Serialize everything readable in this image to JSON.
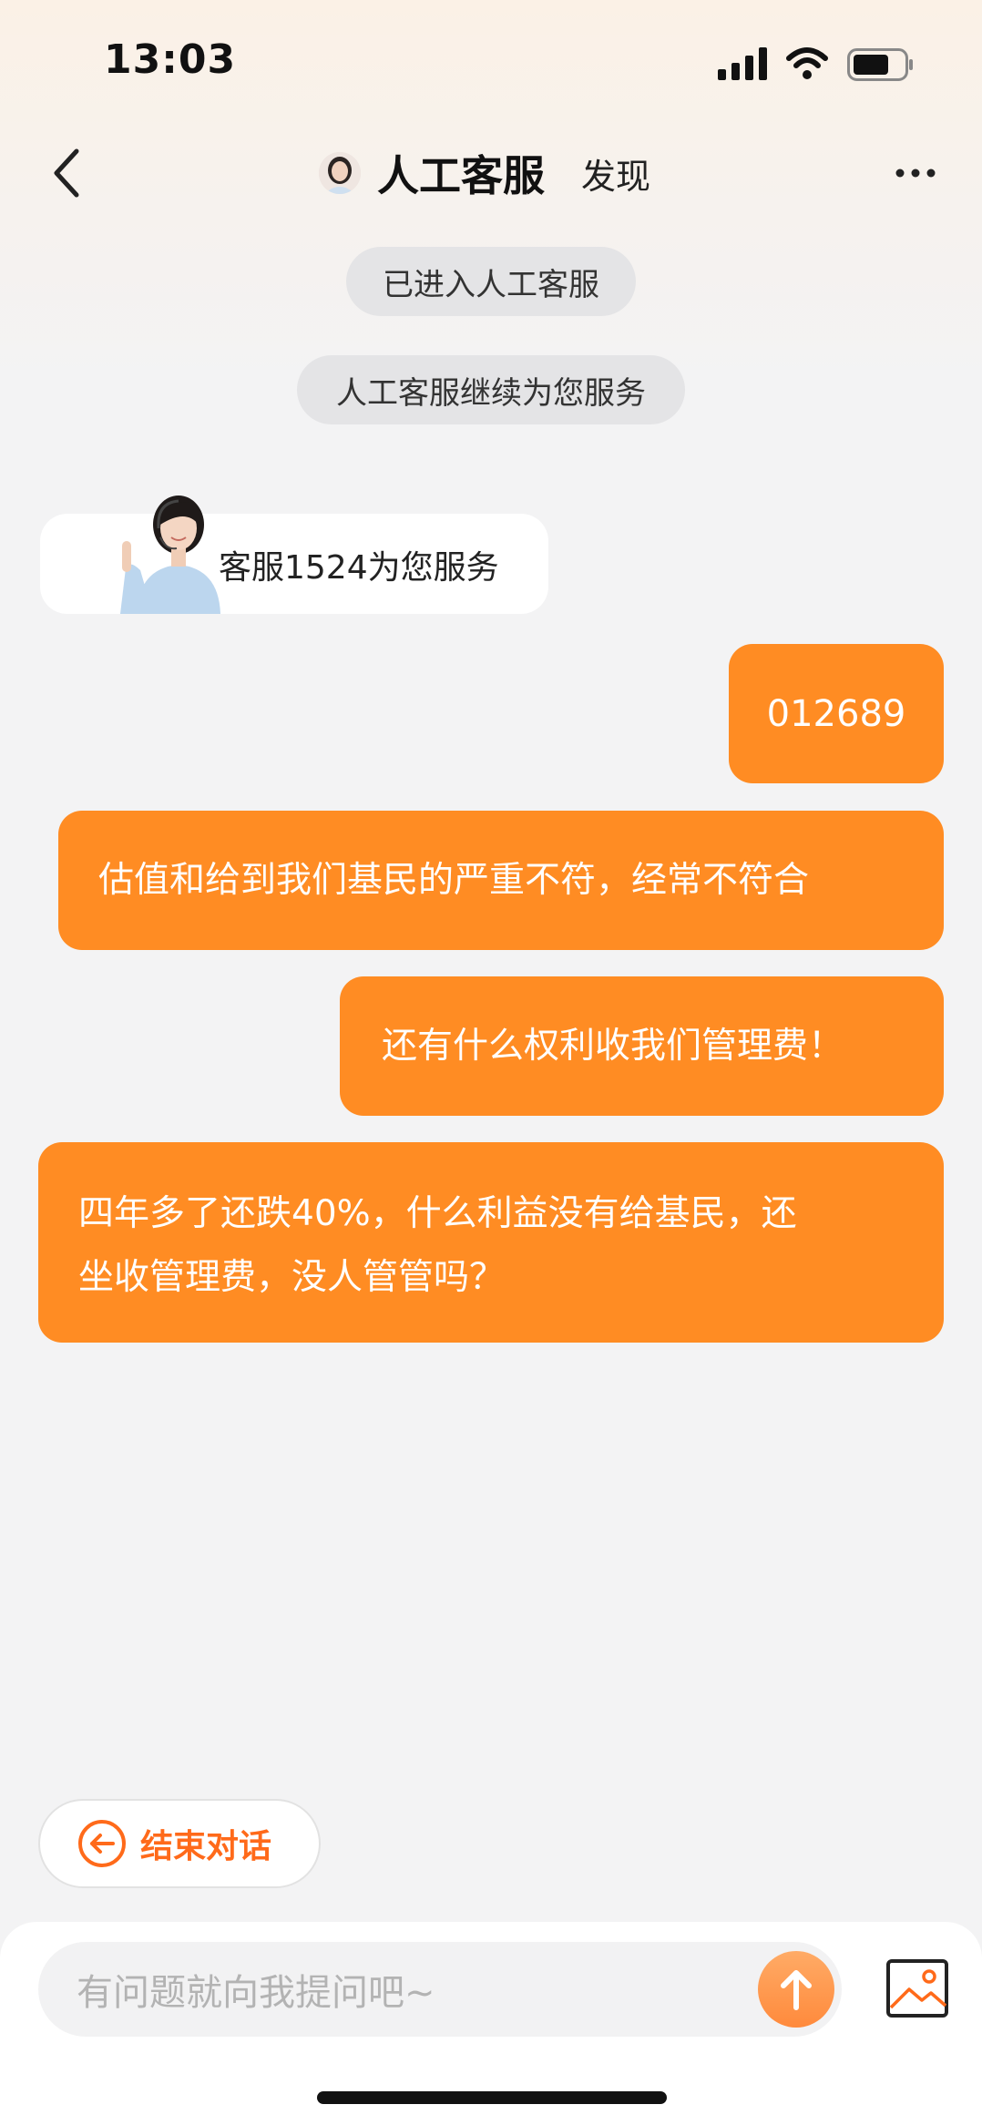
{
  "status_bar": {
    "time": "13:03"
  },
  "nav": {
    "title": "人工客服",
    "discover": "发现"
  },
  "system_messages": [
    "已进入人工客服",
    "人工客服继续为您服务"
  ],
  "agent_card": {
    "text": "客服1524为您服务"
  },
  "messages": [
    {
      "side": "right",
      "text": "012689"
    },
    {
      "side": "right",
      "text": "估值和给到我们基民的严重不符，经常不符合"
    },
    {
      "side": "right",
      "text": "还有什么权利收我们管理费！"
    },
    {
      "side": "right",
      "lines": [
        "四年多了还跌40%，什么利益没有给基民，还",
        "坐收管理费，没人管管吗？"
      ]
    }
  ],
  "end_chat": {
    "label": "结束对话"
  },
  "input": {
    "placeholder": "有问题就向我提问吧~"
  },
  "colors": {
    "accent": "#ff8c23",
    "end_text": "#ff6a1a"
  },
  "icons": [
    "back-icon",
    "more-icon",
    "signal-icon",
    "wifi-icon",
    "battery-icon",
    "end-chat-icon",
    "send-icon",
    "image-icon"
  ]
}
